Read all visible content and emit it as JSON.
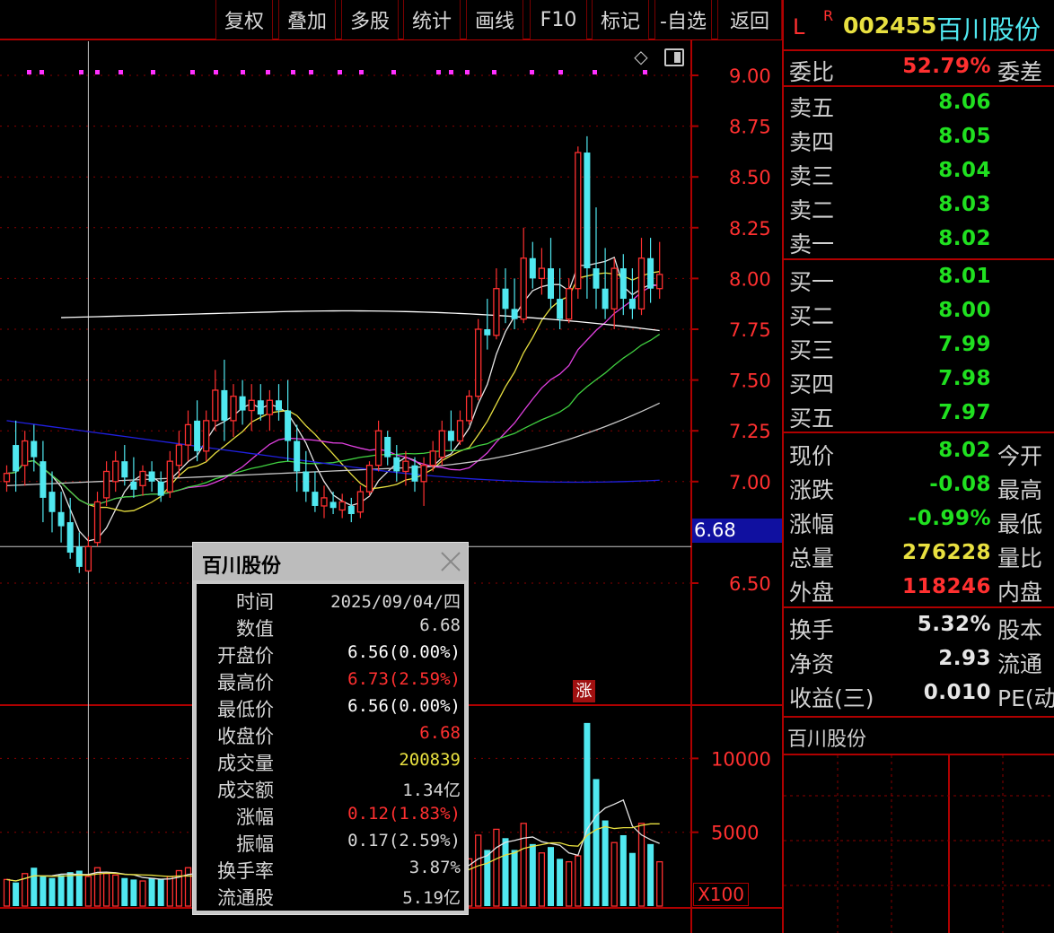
{
  "toolbar": {
    "buttons": [
      "复权",
      "叠加",
      "多股",
      "统计",
      "画线",
      "F10",
      "标记",
      "-自选",
      "返回"
    ]
  },
  "stock": {
    "prefix": "L",
    "sup": "R",
    "code": "002455",
    "name": "百川股份"
  },
  "chart_data": {
    "type": "candlestick",
    "price_ticks": [
      "9.00",
      "8.75",
      "8.50",
      "8.25",
      "8.00",
      "7.75",
      "7.50",
      "7.25",
      "7.00",
      "6.50"
    ],
    "cursor_price": "6.68",
    "ylim": [
      6.3,
      9.1
    ],
    "up_color": "#ff3030",
    "down_color": "#50e8f0",
    "candles": [
      {
        "o": 7.0,
        "h": 7.08,
        "l": 6.95,
        "c": 7.04
      },
      {
        "o": 7.18,
        "h": 7.3,
        "l": 6.95,
        "c": 7.05
      },
      {
        "o": 7.08,
        "h": 7.25,
        "l": 6.98,
        "c": 7.2
      },
      {
        "o": 7.2,
        "h": 7.28,
        "l": 7.05,
        "c": 7.12
      },
      {
        "o": 7.1,
        "h": 7.2,
        "l": 6.8,
        "c": 6.92
      },
      {
        "o": 6.95,
        "h": 7.05,
        "l": 6.75,
        "c": 6.85
      },
      {
        "o": 6.85,
        "h": 6.95,
        "l": 6.7,
        "c": 6.78
      },
      {
        "o": 6.8,
        "h": 6.92,
        "l": 6.62,
        "c": 6.65
      },
      {
        "o": 6.68,
        "h": 6.75,
        "l": 6.55,
        "c": 6.58
      },
      {
        "o": 6.56,
        "h": 6.73,
        "l": 6.56,
        "c": 6.68
      },
      {
        "o": 6.7,
        "h": 6.95,
        "l": 6.68,
        "c": 6.9
      },
      {
        "o": 6.92,
        "h": 7.1,
        "l": 6.88,
        "c": 7.05
      },
      {
        "o": 7.0,
        "h": 7.15,
        "l": 6.95,
        "c": 7.1
      },
      {
        "o": 7.1,
        "h": 7.18,
        "l": 6.98,
        "c": 7.02
      },
      {
        "o": 7.0,
        "h": 7.12,
        "l": 6.92,
        "c": 6.96
      },
      {
        "o": 6.98,
        "h": 7.08,
        "l": 6.93,
        "c": 7.05
      },
      {
        "o": 7.05,
        "h": 7.1,
        "l": 6.95,
        "c": 7.0
      },
      {
        "o": 7.0,
        "h": 7.05,
        "l": 6.9,
        "c": 6.93
      },
      {
        "o": 6.95,
        "h": 7.15,
        "l": 6.92,
        "c": 7.1
      },
      {
        "o": 7.08,
        "h": 7.25,
        "l": 7.02,
        "c": 7.18
      },
      {
        "o": 7.18,
        "h": 7.35,
        "l": 7.1,
        "c": 7.28
      },
      {
        "o": 7.3,
        "h": 7.4,
        "l": 7.1,
        "c": 7.15
      },
      {
        "o": 7.15,
        "h": 7.35,
        "l": 7.1,
        "c": 7.3
      },
      {
        "o": 7.3,
        "h": 7.55,
        "l": 7.25,
        "c": 7.45
      },
      {
        "o": 7.45,
        "h": 7.6,
        "l": 7.2,
        "c": 7.3
      },
      {
        "o": 7.3,
        "h": 7.48,
        "l": 7.22,
        "c": 7.42
      },
      {
        "o": 7.42,
        "h": 7.5,
        "l": 7.28,
        "c": 7.35
      },
      {
        "o": 7.35,
        "h": 7.48,
        "l": 7.25,
        "c": 7.4
      },
      {
        "o": 7.4,
        "h": 7.48,
        "l": 7.3,
        "c": 7.33
      },
      {
        "o": 7.33,
        "h": 7.45,
        "l": 7.25,
        "c": 7.4
      },
      {
        "o": 7.4,
        "h": 7.48,
        "l": 7.3,
        "c": 7.35
      },
      {
        "o": 7.35,
        "h": 7.5,
        "l": 7.1,
        "c": 7.2
      },
      {
        "o": 7.2,
        "h": 7.28,
        "l": 6.95,
        "c": 7.05
      },
      {
        "o": 7.05,
        "h": 7.15,
        "l": 6.9,
        "c": 6.95
      },
      {
        "o": 6.95,
        "h": 7.05,
        "l": 6.85,
        "c": 6.88
      },
      {
        "o": 6.88,
        "h": 6.98,
        "l": 6.82,
        "c": 6.92
      },
      {
        "o": 6.9,
        "h": 6.95,
        "l": 6.84,
        "c": 6.87
      },
      {
        "o": 6.86,
        "h": 6.94,
        "l": 6.82,
        "c": 6.9
      },
      {
        "o": 6.88,
        "h": 6.92,
        "l": 6.8,
        "c": 6.84
      },
      {
        "o": 6.85,
        "h": 6.98,
        "l": 6.82,
        "c": 6.95
      },
      {
        "o": 6.95,
        "h": 7.1,
        "l": 6.93,
        "c": 7.08
      },
      {
        "o": 7.08,
        "h": 7.3,
        "l": 7.05,
        "c": 7.25
      },
      {
        "o": 7.22,
        "h": 7.25,
        "l": 7.08,
        "c": 7.12
      },
      {
        "o": 7.12,
        "h": 7.18,
        "l": 7.0,
        "c": 7.05
      },
      {
        "o": 7.05,
        "h": 7.15,
        "l": 6.98,
        "c": 7.1
      },
      {
        "o": 7.08,
        "h": 7.12,
        "l": 6.95,
        "c": 7.0
      },
      {
        "o": 7.0,
        "h": 7.12,
        "l": 6.88,
        "c": 7.08
      },
      {
        "o": 7.08,
        "h": 7.2,
        "l": 7.05,
        "c": 7.15
      },
      {
        "o": 7.12,
        "h": 7.3,
        "l": 7.08,
        "c": 7.25
      },
      {
        "o": 7.25,
        "h": 7.35,
        "l": 7.15,
        "c": 7.2
      },
      {
        "o": 7.2,
        "h": 7.35,
        "l": 7.18,
        "c": 7.3
      },
      {
        "o": 7.3,
        "h": 7.45,
        "l": 7.28,
        "c": 7.42
      },
      {
        "o": 7.42,
        "h": 7.8,
        "l": 7.4,
        "c": 7.75
      },
      {
        "o": 7.75,
        "h": 7.9,
        "l": 7.65,
        "c": 7.72
      },
      {
        "o": 7.72,
        "h": 8.05,
        "l": 7.7,
        "c": 7.95
      },
      {
        "o": 7.95,
        "h": 8.05,
        "l": 7.78,
        "c": 7.85
      },
      {
        "o": 7.85,
        "h": 8.0,
        "l": 7.75,
        "c": 7.8
      },
      {
        "o": 7.8,
        "h": 8.25,
        "l": 7.78,
        "c": 8.1
      },
      {
        "o": 8.1,
        "h": 8.18,
        "l": 7.95,
        "c": 8.0
      },
      {
        "o": 8.0,
        "h": 8.15,
        "l": 7.92,
        "c": 8.05
      },
      {
        "o": 8.05,
        "h": 8.2,
        "l": 7.85,
        "c": 7.9
      },
      {
        "o": 7.9,
        "h": 8.05,
        "l": 7.75,
        "c": 7.8
      },
      {
        "o": 7.8,
        "h": 8.0,
        "l": 7.78,
        "c": 7.95
      },
      {
        "o": 7.95,
        "h": 8.65,
        "l": 7.9,
        "c": 8.62
      },
      {
        "o": 8.62,
        "h": 8.7,
        "l": 7.9,
        "c": 8.05
      },
      {
        "o": 8.05,
        "h": 8.35,
        "l": 7.85,
        "c": 7.95
      },
      {
        "o": 7.95,
        "h": 8.15,
        "l": 7.8,
        "c": 7.85
      },
      {
        "o": 7.85,
        "h": 8.1,
        "l": 7.75,
        "c": 8.05
      },
      {
        "o": 8.05,
        "h": 8.12,
        "l": 7.82,
        "c": 7.9
      },
      {
        "o": 7.9,
        "h": 8.05,
        "l": 7.8,
        "c": 7.85
      },
      {
        "o": 7.85,
        "h": 8.2,
        "l": 7.82,
        "c": 8.1
      },
      {
        "o": 8.1,
        "h": 8.2,
        "l": 7.88,
        "c": 7.95
      },
      {
        "o": 7.95,
        "h": 8.18,
        "l": 7.9,
        "c": 8.02
      }
    ],
    "volume_ticks": [
      "10000",
      "5000"
    ],
    "volume_unit": "X100",
    "volumes": [
      1800,
      1600,
      2200,
      2600,
      2000,
      1900,
      2100,
      2300,
      2400,
      2008,
      2600,
      2200,
      2100,
      1900,
      1800,
      1700,
      1900,
      1800,
      2000,
      2400,
      2600,
      2200,
      2500,
      2800,
      2400,
      2600,
      2300,
      2500,
      2200,
      2400,
      2300,
      2600,
      2200,
      2000,
      1900,
      2100,
      1800,
      1900,
      2000,
      2200,
      2400,
      2800,
      2300,
      2100,
      2200,
      2000,
      2400,
      2600,
      2700,
      2500,
      2800,
      3200,
      4800,
      3800,
      5200,
      4600,
      3800,
      5600,
      4200,
      3600,
      4000,
      3200,
      3000,
      3400,
      12400,
      8600,
      5800,
      4300,
      4800,
      3600,
      5600,
      4200,
      3000
    ]
  },
  "marker": "涨",
  "tooltip": {
    "title": "百川股份",
    "rows": [
      {
        "k": "时间",
        "v": "2025/09/04/四",
        "color": "#d6d6d6"
      },
      {
        "k": "数值",
        "v": "6.68",
        "color": "#d6d6d6"
      },
      {
        "k": "开盘价",
        "v": "6.56(0.00%)",
        "color": "#ffffff"
      },
      {
        "k": "最高价",
        "v": "6.73(2.59%)",
        "color": "#ff3030"
      },
      {
        "k": "最低价",
        "v": "6.56(0.00%)",
        "color": "#ffffff"
      },
      {
        "k": "收盘价",
        "v": "6.68",
        "color": "#ff3030"
      },
      {
        "k": "成交量",
        "v": "200839",
        "color": "#e8e040"
      },
      {
        "k": "成交额",
        "v": "1.34亿",
        "color": "#d6d6d6"
      },
      {
        "k": "涨幅",
        "v": "0.12(1.83%)",
        "color": "#ff3030"
      },
      {
        "k": "振幅",
        "v": "0.17(2.59%)",
        "color": "#d6d6d6"
      },
      {
        "k": "换手率",
        "v": "3.87%",
        "color": "#d6d6d6"
      },
      {
        "k": "流通股",
        "v": "5.19亿",
        "color": "#d6d6d6"
      }
    ]
  },
  "quote": {
    "weibi": {
      "label": "委比",
      "value": "52.79%",
      "label2": "委差"
    },
    "asks": [
      {
        "label": "卖五",
        "value": "8.06"
      },
      {
        "label": "卖四",
        "value": "8.05"
      },
      {
        "label": "卖三",
        "value": "8.04"
      },
      {
        "label": "卖二",
        "value": "8.03"
      },
      {
        "label": "卖一",
        "value": "8.02"
      }
    ],
    "bids": [
      {
        "label": "买一",
        "value": "8.01"
      },
      {
        "label": "买二",
        "value": "8.00"
      },
      {
        "label": "买三",
        "value": "7.99"
      },
      {
        "label": "买四",
        "value": "7.98"
      },
      {
        "label": "买五",
        "value": "7.97"
      }
    ],
    "stats": [
      {
        "label": "现价",
        "value": "8.02",
        "color": "green",
        "label2": "今开"
      },
      {
        "label": "涨跌",
        "value": "-0.08",
        "color": "green",
        "label2": "最高"
      },
      {
        "label": "涨幅",
        "value": "-0.99%",
        "color": "green",
        "label2": "最低"
      },
      {
        "label": "总量",
        "value": "276228",
        "color": "yellow",
        "label2": "量比"
      },
      {
        "label": "外盘",
        "value": "118246",
        "color": "red",
        "label2": "内盘"
      }
    ],
    "stats2": [
      {
        "label": "换手",
        "value": "5.32%",
        "color": "white",
        "label2": "股本"
      },
      {
        "label": "净资",
        "value": "2.93",
        "color": "white",
        "label2": "流通"
      },
      {
        "label": "收益(三)",
        "value": "0.010",
        "color": "white",
        "label2": "PE(动"
      }
    ],
    "footer_name": "百川股份"
  },
  "colors": {
    "grid": "#8a0000",
    "axis": "#b00000",
    "ma5": "#e6e6e6",
    "ma10": "#e8e040",
    "ma20": "#e040e0",
    "ma30": "#40d040",
    "ma60": "#c8c8c8",
    "ma120": "#2020e0",
    "ma250": "#ffffff"
  }
}
